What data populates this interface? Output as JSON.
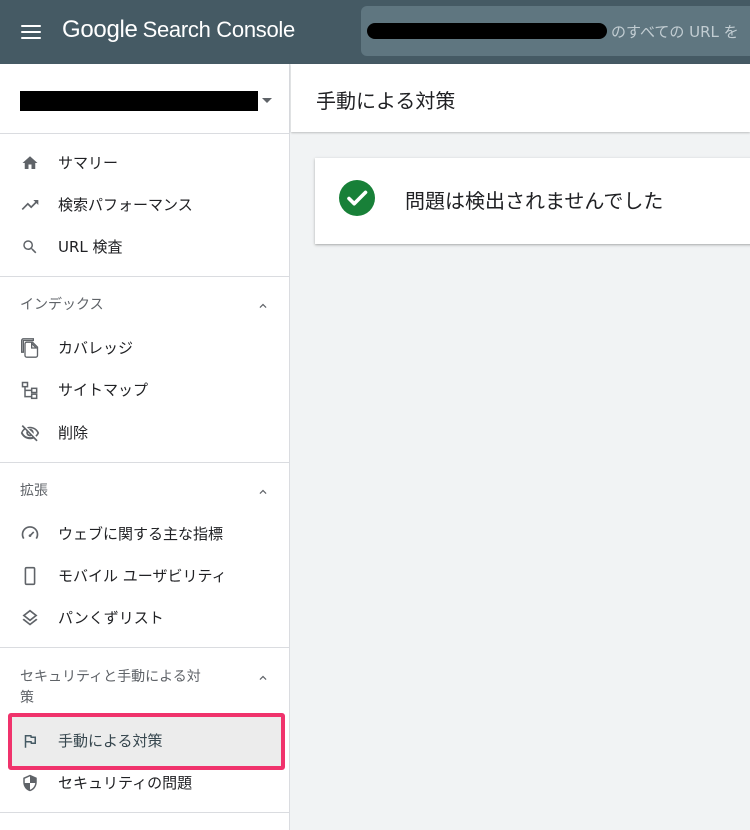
{
  "app": {
    "brand_google": "Google",
    "brand_product": "Search Console"
  },
  "search": {
    "placeholder_suffix": "のすべての URL を"
  },
  "sidebar": {
    "items_main": [
      {
        "label": "サマリー",
        "icon": "home-icon"
      },
      {
        "label": "検索パフォーマンス",
        "icon": "trending-up-icon"
      },
      {
        "label": "URL 検査",
        "icon": "search-icon"
      }
    ],
    "sections": [
      {
        "title": "インデックス",
        "items": [
          {
            "label": "カバレッジ",
            "icon": "file-copy-icon"
          },
          {
            "label": "サイトマップ",
            "icon": "sitemap-icon"
          },
          {
            "label": "削除",
            "icon": "visibility-off-icon"
          }
        ]
      },
      {
        "title": "拡張",
        "items": [
          {
            "label": "ウェブに関する主な指標",
            "icon": "speed-gauge-icon"
          },
          {
            "label": "モバイル ユーザビリティ",
            "icon": "smartphone-icon"
          },
          {
            "label": "パンくずリスト",
            "icon": "layers-icon"
          }
        ]
      },
      {
        "title_line1": "セキュリティと手動による対",
        "title_line2": "策",
        "items": [
          {
            "label": "手動による対策",
            "icon": "flag-icon",
            "active": true
          },
          {
            "label": "セキュリティの問題",
            "icon": "shield-icon"
          }
        ]
      }
    ]
  },
  "main": {
    "page_title": "手動による対策",
    "status_message": "問題は検出されませんでした"
  },
  "colors": {
    "topbar": "#455a64",
    "success": "#188038",
    "highlight_border": "#f0336c"
  }
}
